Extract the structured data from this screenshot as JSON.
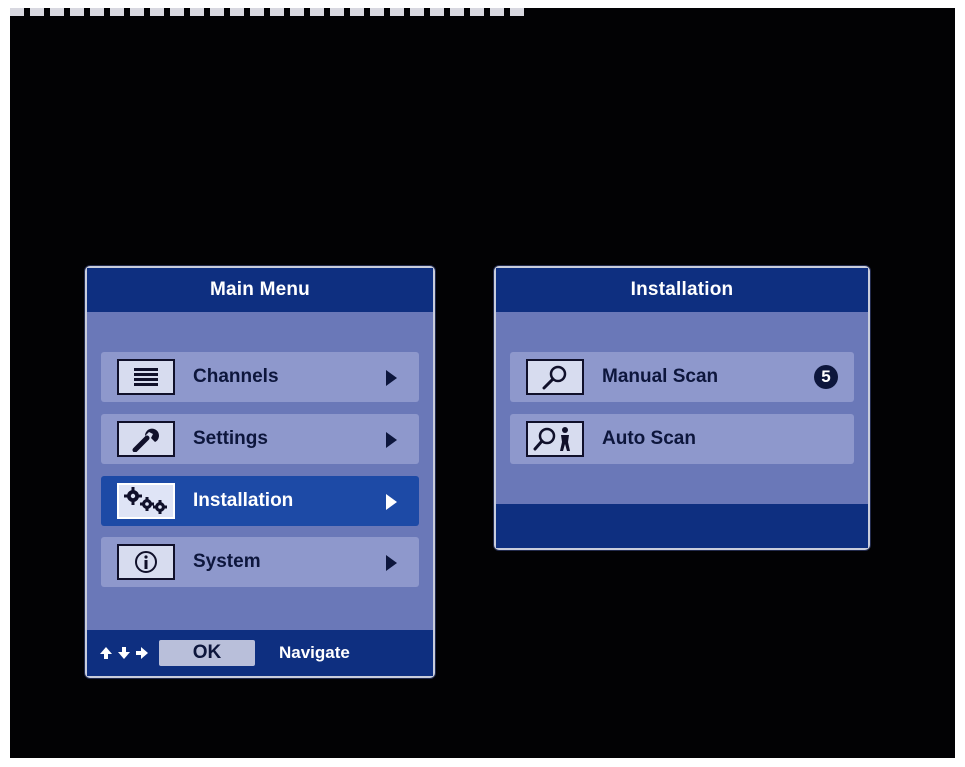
{
  "main_menu": {
    "title": "Main Menu",
    "items": [
      {
        "label": "Channels",
        "icon": "list-icon",
        "selected": false
      },
      {
        "label": "Settings",
        "icon": "wrench-icon",
        "selected": false
      },
      {
        "label": "Installation",
        "icon": "gears-icon",
        "selected": true
      },
      {
        "label": "System",
        "icon": "info-icon",
        "selected": false
      }
    ],
    "footer": {
      "nav_icons": [
        "arrow-up-icon",
        "arrow-down-icon",
        "arrow-right-icon"
      ],
      "ok_label": "OK",
      "nav_label": "Navigate"
    }
  },
  "installation_menu": {
    "title": "Installation",
    "items": [
      {
        "label": "Manual Scan",
        "icon": "magnifier-icon",
        "badge": "5"
      },
      {
        "label": "Auto Scan",
        "icon": "magnifier-person-icon"
      }
    ]
  },
  "colors": {
    "header_blue": "#0e2f80",
    "panel_body": "#6a78b8",
    "row_bg": "#8e98cc",
    "selected_row": "#1d4aa6",
    "screen_bg": "#020204"
  }
}
